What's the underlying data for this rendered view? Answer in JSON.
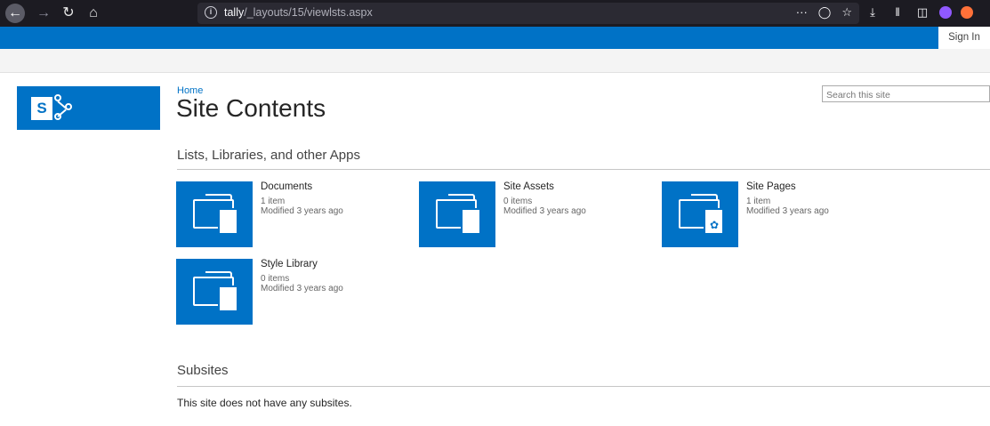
{
  "browser": {
    "url_host": "tally",
    "url_path": "/_layouts/15/viewlsts.aspx",
    "url_more": "···"
  },
  "suite_bar": {
    "sign_in": "Sign In",
    "accent": "#0072c6"
  },
  "header": {
    "breadcrumb": "Home",
    "title": "Site Contents",
    "search_placeholder": "Search this site"
  },
  "apps_section": {
    "heading": "Lists, Libraries, and other Apps",
    "tiles": [
      {
        "title": "Documents",
        "count": "1 item",
        "modified": "Modified 3 years ago",
        "icon": "document-library-icon"
      },
      {
        "title": "Site Assets",
        "count": "0 items",
        "modified": "Modified 3 years ago",
        "icon": "document-library-icon"
      },
      {
        "title": "Site Pages",
        "count": "1 item",
        "modified": "Modified 3 years ago",
        "icon": "wiki-page-library-icon"
      },
      {
        "title": "Style Library",
        "count": "0 items",
        "modified": "Modified 3 years ago",
        "icon": "document-library-icon"
      }
    ]
  },
  "subsites_section": {
    "heading": "Subsites",
    "empty_message": "This site does not have any subsites."
  }
}
